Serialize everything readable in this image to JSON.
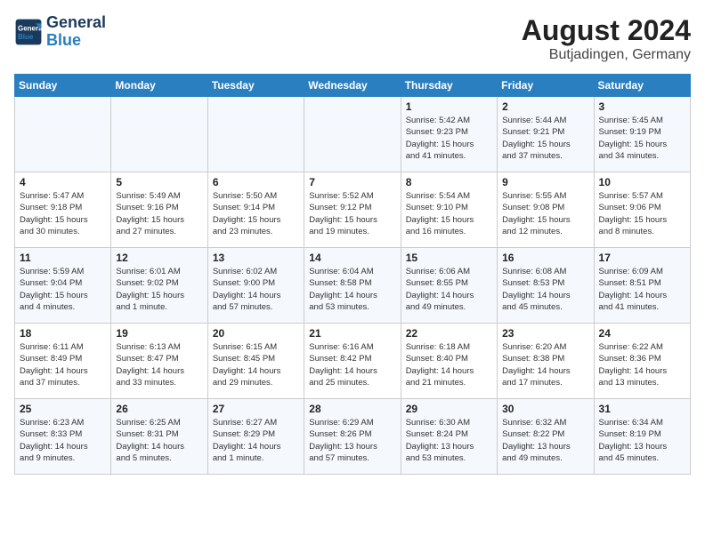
{
  "header": {
    "logo_line1": "General",
    "logo_line2": "Blue",
    "month_year": "August 2024",
    "location": "Butjadingen, Germany"
  },
  "weekdays": [
    "Sunday",
    "Monday",
    "Tuesday",
    "Wednesday",
    "Thursday",
    "Friday",
    "Saturday"
  ],
  "weeks": [
    [
      {
        "day": "",
        "info": ""
      },
      {
        "day": "",
        "info": ""
      },
      {
        "day": "",
        "info": ""
      },
      {
        "day": "",
        "info": ""
      },
      {
        "day": "1",
        "info": "Sunrise: 5:42 AM\nSunset: 9:23 PM\nDaylight: 15 hours\nand 41 minutes."
      },
      {
        "day": "2",
        "info": "Sunrise: 5:44 AM\nSunset: 9:21 PM\nDaylight: 15 hours\nand 37 minutes."
      },
      {
        "day": "3",
        "info": "Sunrise: 5:45 AM\nSunset: 9:19 PM\nDaylight: 15 hours\nand 34 minutes."
      }
    ],
    [
      {
        "day": "4",
        "info": "Sunrise: 5:47 AM\nSunset: 9:18 PM\nDaylight: 15 hours\nand 30 minutes."
      },
      {
        "day": "5",
        "info": "Sunrise: 5:49 AM\nSunset: 9:16 PM\nDaylight: 15 hours\nand 27 minutes."
      },
      {
        "day": "6",
        "info": "Sunrise: 5:50 AM\nSunset: 9:14 PM\nDaylight: 15 hours\nand 23 minutes."
      },
      {
        "day": "7",
        "info": "Sunrise: 5:52 AM\nSunset: 9:12 PM\nDaylight: 15 hours\nand 19 minutes."
      },
      {
        "day": "8",
        "info": "Sunrise: 5:54 AM\nSunset: 9:10 PM\nDaylight: 15 hours\nand 16 minutes."
      },
      {
        "day": "9",
        "info": "Sunrise: 5:55 AM\nSunset: 9:08 PM\nDaylight: 15 hours\nand 12 minutes."
      },
      {
        "day": "10",
        "info": "Sunrise: 5:57 AM\nSunset: 9:06 PM\nDaylight: 15 hours\nand 8 minutes."
      }
    ],
    [
      {
        "day": "11",
        "info": "Sunrise: 5:59 AM\nSunset: 9:04 PM\nDaylight: 15 hours\nand 4 minutes."
      },
      {
        "day": "12",
        "info": "Sunrise: 6:01 AM\nSunset: 9:02 PM\nDaylight: 15 hours\nand 1 minute."
      },
      {
        "day": "13",
        "info": "Sunrise: 6:02 AM\nSunset: 9:00 PM\nDaylight: 14 hours\nand 57 minutes."
      },
      {
        "day": "14",
        "info": "Sunrise: 6:04 AM\nSunset: 8:58 PM\nDaylight: 14 hours\nand 53 minutes."
      },
      {
        "day": "15",
        "info": "Sunrise: 6:06 AM\nSunset: 8:55 PM\nDaylight: 14 hours\nand 49 minutes."
      },
      {
        "day": "16",
        "info": "Sunrise: 6:08 AM\nSunset: 8:53 PM\nDaylight: 14 hours\nand 45 minutes."
      },
      {
        "day": "17",
        "info": "Sunrise: 6:09 AM\nSunset: 8:51 PM\nDaylight: 14 hours\nand 41 minutes."
      }
    ],
    [
      {
        "day": "18",
        "info": "Sunrise: 6:11 AM\nSunset: 8:49 PM\nDaylight: 14 hours\nand 37 minutes."
      },
      {
        "day": "19",
        "info": "Sunrise: 6:13 AM\nSunset: 8:47 PM\nDaylight: 14 hours\nand 33 minutes."
      },
      {
        "day": "20",
        "info": "Sunrise: 6:15 AM\nSunset: 8:45 PM\nDaylight: 14 hours\nand 29 minutes."
      },
      {
        "day": "21",
        "info": "Sunrise: 6:16 AM\nSunset: 8:42 PM\nDaylight: 14 hours\nand 25 minutes."
      },
      {
        "day": "22",
        "info": "Sunrise: 6:18 AM\nSunset: 8:40 PM\nDaylight: 14 hours\nand 21 minutes."
      },
      {
        "day": "23",
        "info": "Sunrise: 6:20 AM\nSunset: 8:38 PM\nDaylight: 14 hours\nand 17 minutes."
      },
      {
        "day": "24",
        "info": "Sunrise: 6:22 AM\nSunset: 8:36 PM\nDaylight: 14 hours\nand 13 minutes."
      }
    ],
    [
      {
        "day": "25",
        "info": "Sunrise: 6:23 AM\nSunset: 8:33 PM\nDaylight: 14 hours\nand 9 minutes."
      },
      {
        "day": "26",
        "info": "Sunrise: 6:25 AM\nSunset: 8:31 PM\nDaylight: 14 hours\nand 5 minutes."
      },
      {
        "day": "27",
        "info": "Sunrise: 6:27 AM\nSunset: 8:29 PM\nDaylight: 14 hours\nand 1 minute."
      },
      {
        "day": "28",
        "info": "Sunrise: 6:29 AM\nSunset: 8:26 PM\nDaylight: 13 hours\nand 57 minutes."
      },
      {
        "day": "29",
        "info": "Sunrise: 6:30 AM\nSunset: 8:24 PM\nDaylight: 13 hours\nand 53 minutes."
      },
      {
        "day": "30",
        "info": "Sunrise: 6:32 AM\nSunset: 8:22 PM\nDaylight: 13 hours\nand 49 minutes."
      },
      {
        "day": "31",
        "info": "Sunrise: 6:34 AM\nSunset: 8:19 PM\nDaylight: 13 hours\nand 45 minutes."
      }
    ]
  ]
}
